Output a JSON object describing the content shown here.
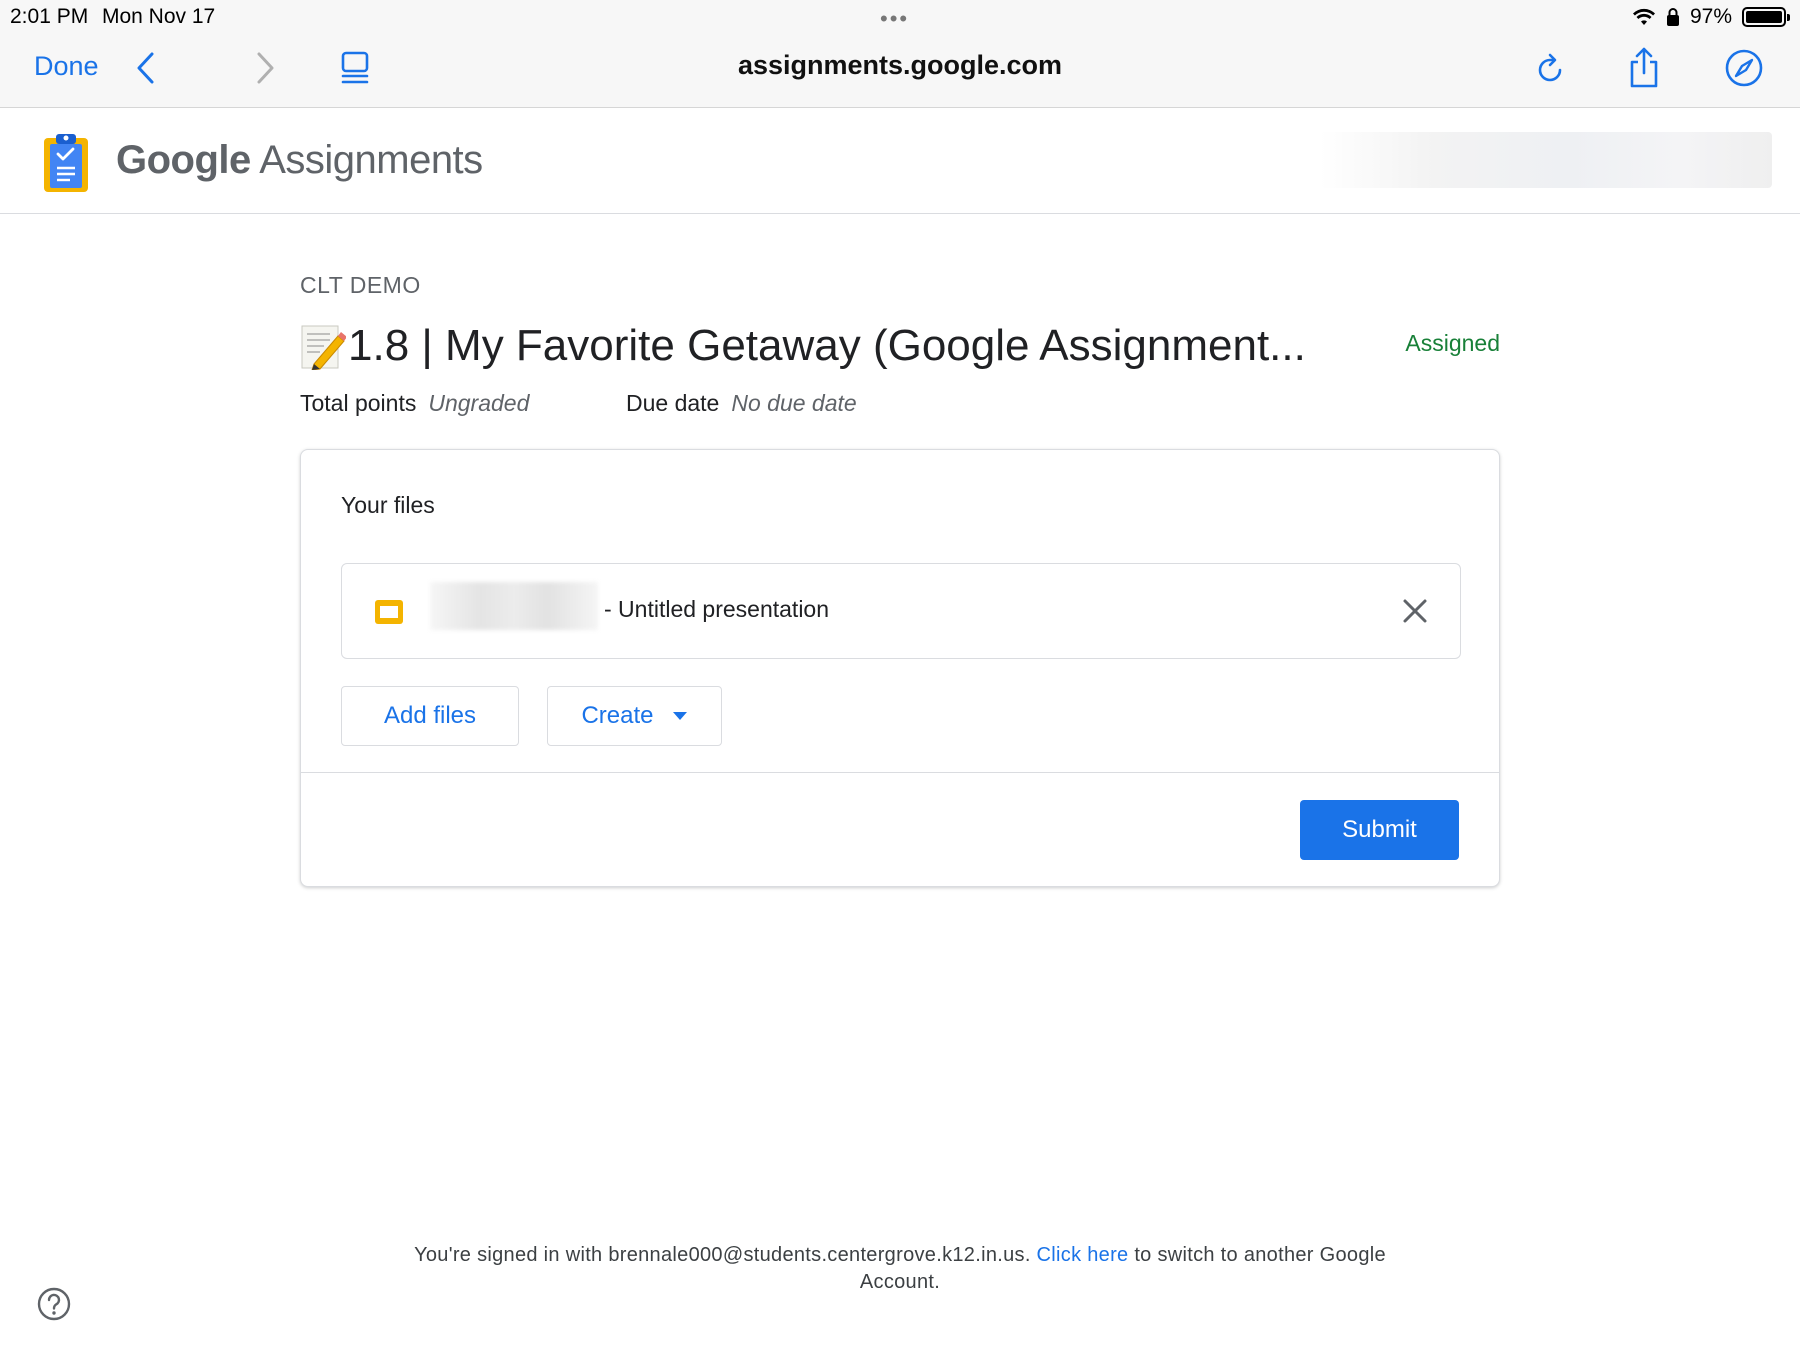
{
  "status_bar": {
    "time": "2:01 PM",
    "date": "Mon Nov 17",
    "battery": "97%",
    "icons": [
      "wifi-icon",
      "lock-icon",
      "battery-icon"
    ]
  },
  "browser": {
    "done_label": "Done",
    "url": "assignments.google.com",
    "icons": [
      "back-arrow-icon",
      "forward-arrow-icon",
      "reader-icon",
      "reload-icon",
      "share-icon",
      "compass-icon"
    ],
    "accent": "#1a73e8"
  },
  "app": {
    "brand_google": "Google",
    "brand_product": "Assignments"
  },
  "assignment": {
    "course": "CLT DEMO",
    "title": "1.8 | My Favorite Getaway (Google Assignment...",
    "status": "Assigned",
    "status_color": "#188038",
    "total_points_label": "Total points",
    "total_points_value": "Ungraded",
    "due_date_label": "Due date",
    "due_date_value": "No due date"
  },
  "files_card": {
    "title": "Your files",
    "files": [
      {
        "name": "- Untitled presentation",
        "icon": "slides-icon",
        "icon_color": "#f4b400"
      }
    ],
    "add_files_label": "Add files",
    "create_label": "Create",
    "submit_label": "Submit"
  },
  "footer": {
    "text_before": "You're signed in with brennale000@students.centergrove.k12.in.us.",
    "link_text": "Click here",
    "text_after": "to switch to another Google",
    "text_line2": "Account."
  }
}
